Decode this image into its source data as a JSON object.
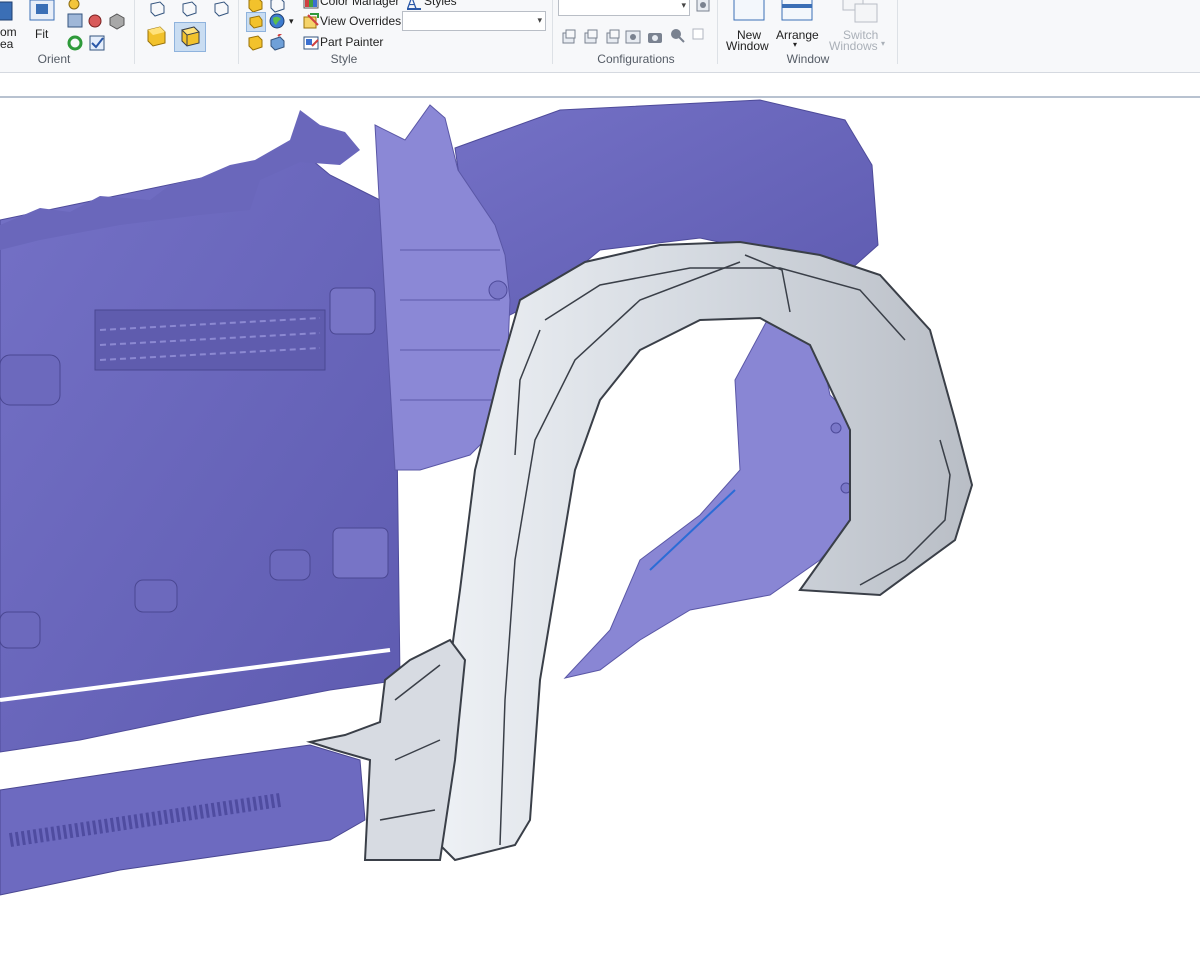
{
  "ribbon": {
    "orient": {
      "zoom_area_label_partial": "om\nea",
      "fit_label": "Fit",
      "group_label": "Orient"
    },
    "style": {
      "color_manager_label": "Color Manager",
      "styles_label": "Styles",
      "view_overrides_label": "View Overrides",
      "part_painter_label": "Part Painter",
      "group_label": "Style",
      "combo_value": ""
    },
    "configurations": {
      "group_label": "Configurations",
      "combo_value": ""
    },
    "window": {
      "new_window_label_1": "New",
      "new_window_label_2": "Window",
      "arrange_label": "Arrange",
      "switch_windows_label_1": "Switch",
      "switch_windows_label_2": "Windows",
      "group_label": "Window"
    }
  },
  "viewport": {
    "model_colors": {
      "scan_mesh": "#6f6cc0",
      "scan_mesh_light": "#8f8cd8",
      "fender_surface": "#d9dde3",
      "fender_edge": "#3a3f48",
      "curve": "#2b6cd6"
    }
  }
}
